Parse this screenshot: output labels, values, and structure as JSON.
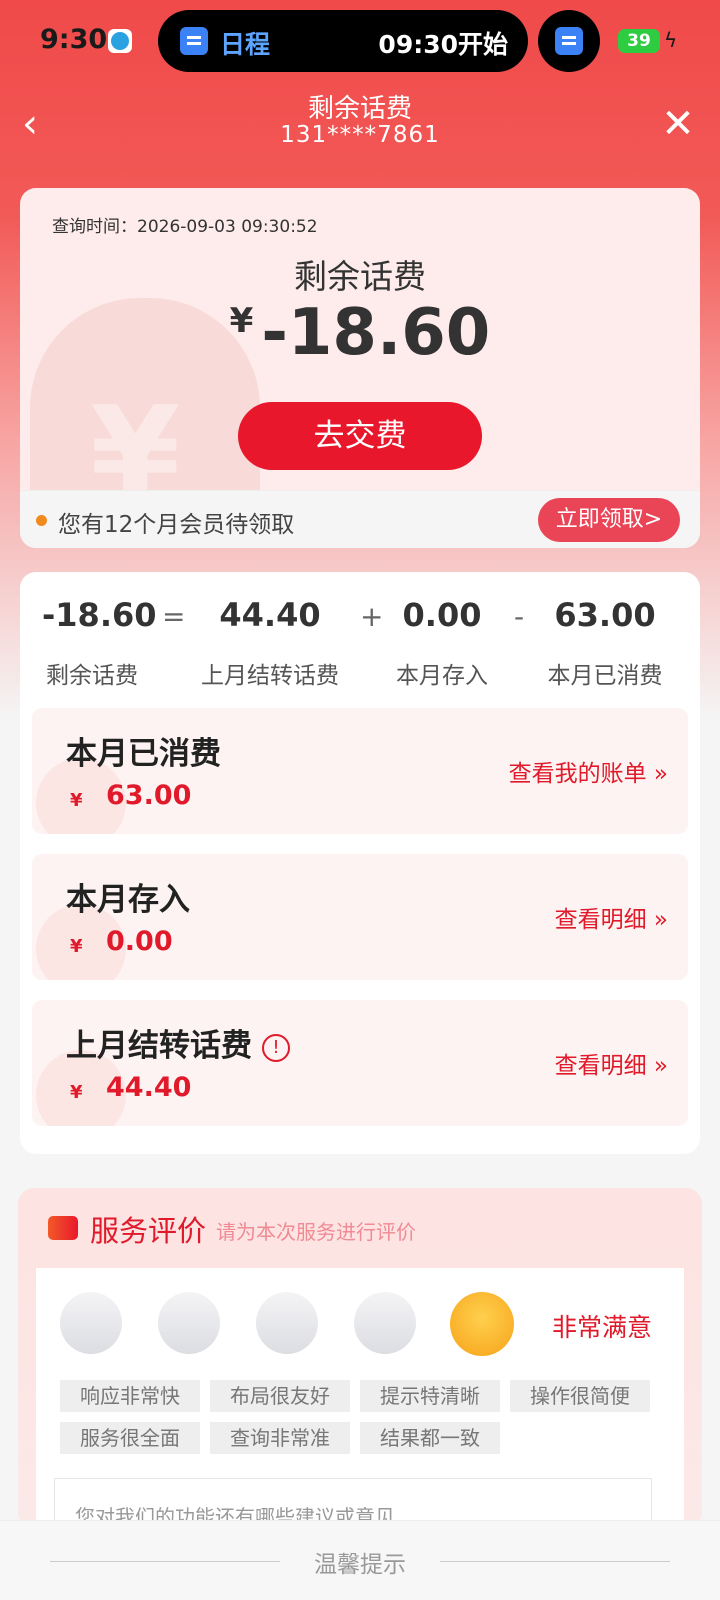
{
  "status_bar": {
    "time": "9:30",
    "island_app": "日程",
    "island_time": "09:30开始",
    "battery": "39"
  },
  "header": {
    "title": "剩余话费",
    "phone": "131****7861"
  },
  "balance": {
    "query_time": "查询时间：2026-09-03 09:30:52",
    "label": "剩余话费",
    "currency": "¥",
    "amount": "-18.60",
    "pay_button": "去交费",
    "member_text": "您有12个月会员待领取",
    "claim_button": "立即领取>"
  },
  "equation": {
    "values": [
      "-18.60",
      "44.40",
      "0.00",
      "63.00"
    ],
    "operators": [
      "=",
      "+",
      "-"
    ],
    "labels": [
      "剩余话费",
      "上月结转话费",
      "本月存入",
      "本月已消费"
    ]
  },
  "details": [
    {
      "title": "本月已消费",
      "currency": "¥",
      "amount": "63.00",
      "link": "查看我的账单"
    },
    {
      "title": "本月存入",
      "currency": "¥",
      "amount": "0.00",
      "link": "查看明细"
    },
    {
      "title": "上月结转话费",
      "currency": "¥",
      "amount": "44.40",
      "link": "查看明细"
    }
  ],
  "evaluation": {
    "title": "服务评价",
    "subtitle": "请为本次服务进行评价",
    "selected_label": "非常满意",
    "tags": [
      "响应非常快",
      "布局很友好",
      "提示特清晰",
      "操作很简便",
      "服务很全面",
      "查询非常准",
      "结果都一致"
    ],
    "suggestion_placeholder": "您对我们的功能还有哪些建议或意见"
  },
  "tips": {
    "title": "温馨提示"
  },
  "colors": {
    "brand_red": "#e8172b",
    "header_red": "#f04a4a"
  }
}
